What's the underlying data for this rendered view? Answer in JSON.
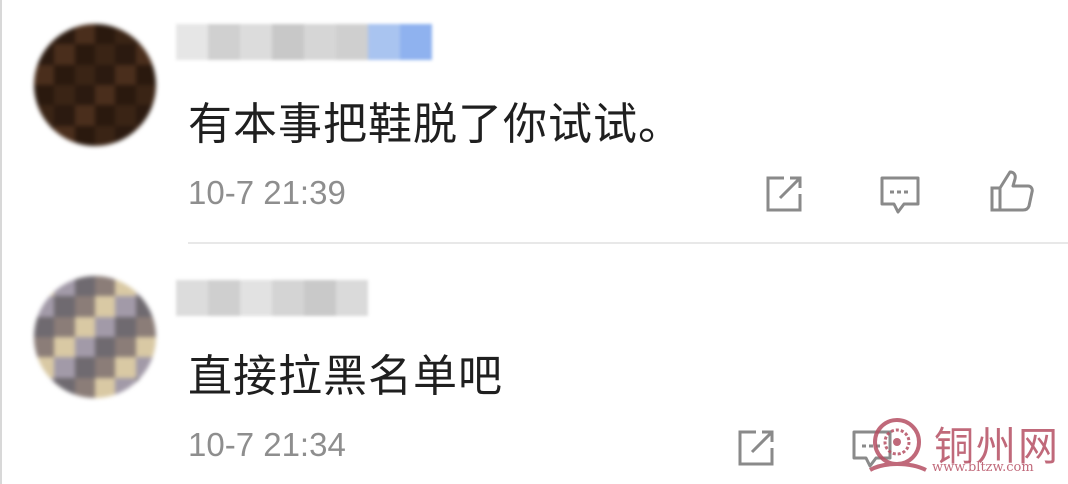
{
  "comments": [
    {
      "text": "有本事把鞋脱了你试试。",
      "timestamp": "10-7 21:39",
      "avatar_colors": [
        "#3a2415",
        "#2a190e",
        "#4a2e1c",
        "#2b1a10"
      ],
      "username_colors": [
        "#e6e6e6",
        "#d0d0d0",
        "#dcdcdc",
        "#c8c8c8",
        "#d6d6d6",
        "#cfcfcf",
        "#a9c4f0",
        "#8fb2ef"
      ]
    },
    {
      "text": "直接拉黑名单吧",
      "timestamp": "10-7 21:34",
      "avatar_colors": [
        "#d9c9a4",
        "#8b7d78",
        "#6f6a70",
        "#a29aa8"
      ],
      "username_colors": [
        "#dcdcdc",
        "#cfcfcf",
        "#e2e2e2",
        "#d4d4d4",
        "#c9c9c9",
        "#dadada"
      ]
    }
  ],
  "actions": {
    "share_icon": "share-icon",
    "reply_icon": "reply-icon",
    "like_icon": "thumbs-up-icon"
  },
  "watermark": {
    "title": "铜州网",
    "url": "www.bltzw.com",
    "color": "#b64f63"
  }
}
